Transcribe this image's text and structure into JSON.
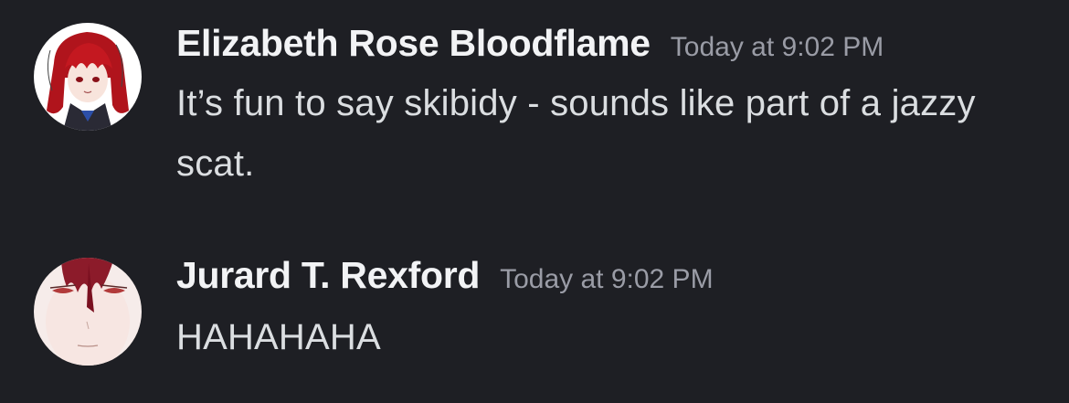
{
  "messages": [
    {
      "username": "Elizabeth Rose Bloodflame",
      "timestamp": "Today at 9:02 PM",
      "text": "It’s fun to say skibidy - sounds like part of a jazzy scat.",
      "avatar": "red-haired-girl-avatar"
    },
    {
      "username": "Jurard T. Rexford",
      "timestamp": "Today at 9:02 PM",
      "text": "HAHAHAHA",
      "avatar": "red-haired-boy-avatar"
    }
  ],
  "colors": {
    "background": "#1e1f24",
    "username": "#f2f3f5",
    "timestamp": "#9a9ca6",
    "message_text": "#dbdee1"
  }
}
